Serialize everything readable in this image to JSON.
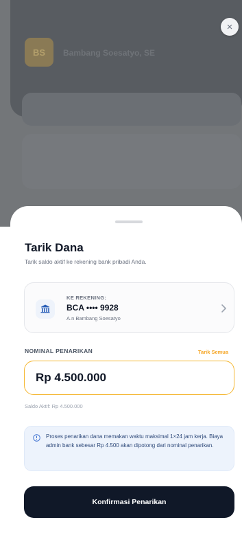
{
  "background": {
    "avatar_initials": "BS",
    "user_name": "Bambang Soesatyo, SE"
  },
  "close": {
    "icon": "close-icon",
    "glyph": "×"
  },
  "sheet": {
    "title": "Tarik Dana",
    "subtitle": "Tarik saldo aktif ke rekening bank pribadi Anda."
  },
  "account": {
    "label": "KE REKENING:",
    "number": "BCA •••• 9928",
    "holder": "A.n Bambang Soesatyo",
    "icon": "bank-icon"
  },
  "nominal": {
    "label": "NOMINAL PENARIKAN",
    "withdraw_all": "Tarik Semua",
    "value": "Rp 4.500.000",
    "saldo": "Saldo Aktif: Rp 4.500.000"
  },
  "info": {
    "text": "Proses penarikan dana memakan waktu maksimal 1×24 jam kerja. Biaya admin bank sebesar Rp 4.500 akan dipotong dari nominal penarikan."
  },
  "confirm_label": "Konfirmasi Penarikan",
  "colors": {
    "accent": "#f5a524",
    "primary": "#101828",
    "info_bg": "#edf3fc"
  }
}
